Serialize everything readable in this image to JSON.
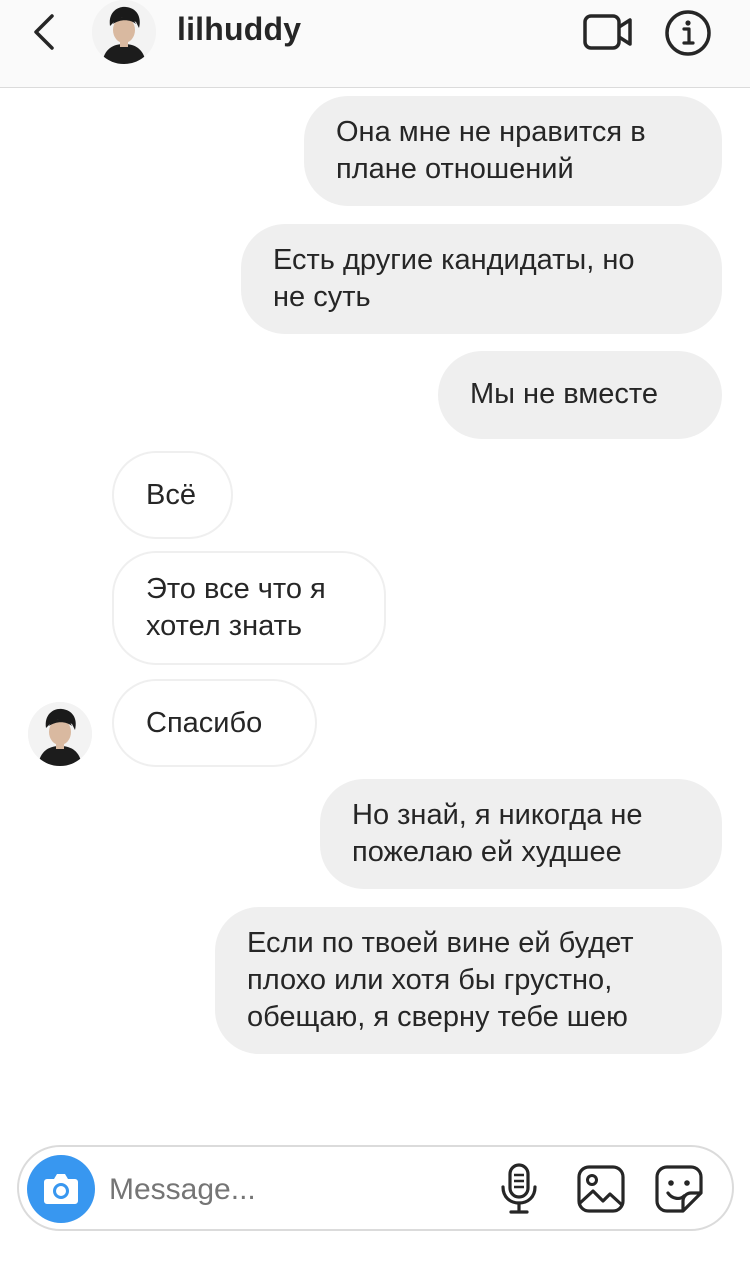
{
  "header": {
    "username": "lilhuddy",
    "icons": [
      "chevron-left-icon",
      "avatar",
      "video-camera-icon",
      "info-icon"
    ]
  },
  "messages": [
    {
      "side": "out",
      "text": "Она мне не нравится в\nплане отношений"
    },
    {
      "side": "out",
      "text": "Есть другие кандидаты, но\nне суть"
    },
    {
      "side": "out",
      "text": "Мы не вместе"
    },
    {
      "side": "in",
      "text": "Всё"
    },
    {
      "side": "in",
      "text": "Это все что я\nхотел знать"
    },
    {
      "side": "in",
      "text": "Спасибо"
    },
    {
      "side": "out",
      "text": "Но знай, я никогда не\nпожелаю ей худшее"
    },
    {
      "side": "out",
      "text": "Если по твоей вине ей будет\nплохо или хотя бы грустно,\nобещаю, я сверну тебе шею"
    }
  ],
  "composer": {
    "placeholder": "Message..."
  },
  "colors": {
    "accent": "#3897f0",
    "outgoing_bubble": "#efefef",
    "border": "#dbdbdb",
    "text": "#262626",
    "placeholder": "#a8a8a8"
  }
}
